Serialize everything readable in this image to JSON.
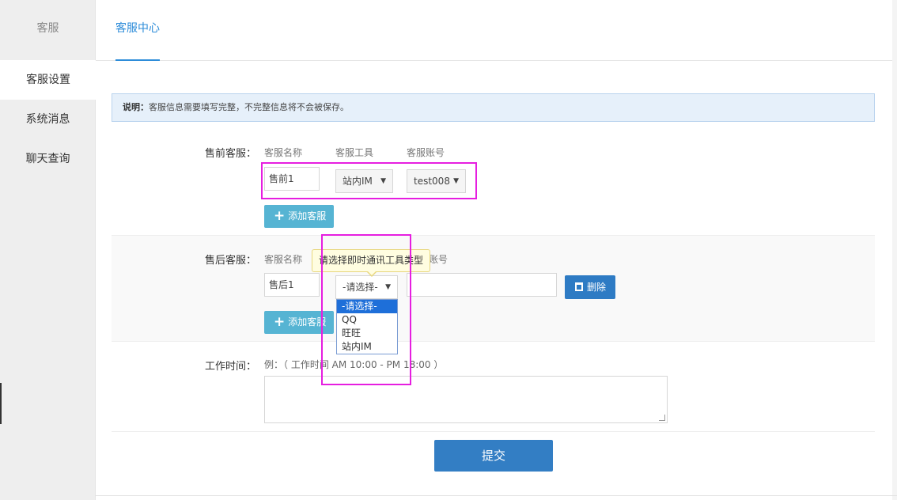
{
  "sidebar": {
    "header": "客服",
    "items": [
      {
        "label": "客服设置"
      },
      {
        "label": "系统消息"
      },
      {
        "label": "聊天查询"
      }
    ]
  },
  "topbar": {
    "tab": "客服中心"
  },
  "notice": {
    "prefix": "说明：",
    "text": "客服信息需要填写完整，不完整信息将不会被保存。"
  },
  "columns": {
    "name": "客服名称",
    "tool": "客服工具",
    "account": "客服账号"
  },
  "presale": {
    "label": "售前客服：",
    "name_value": "售前1",
    "tool_value": "站内IM",
    "account_value": "test008",
    "add_label": "添加客服"
  },
  "aftersale": {
    "label": "售后客服：",
    "name_value": "售后1",
    "tool_value": "-请选择-",
    "account_value": "",
    "account_label_partial": "账号",
    "delete_label": "删除",
    "add_label": "添加客服",
    "tooltip": "请选择即时通讯工具类型",
    "options": [
      "-请选择-",
      "QQ",
      "旺旺",
      "站内IM"
    ]
  },
  "worktime": {
    "label": "工作时间：",
    "hint": "例：（ 工作时间 AM 10:00 - PM 18:00 ）",
    "value": ""
  },
  "submit_label": "提交",
  "colors": {
    "accent": "#2d8cd9",
    "highlight": "#e61ee0",
    "add_button": "#56b4d3",
    "submit_button": "#337ec4"
  }
}
